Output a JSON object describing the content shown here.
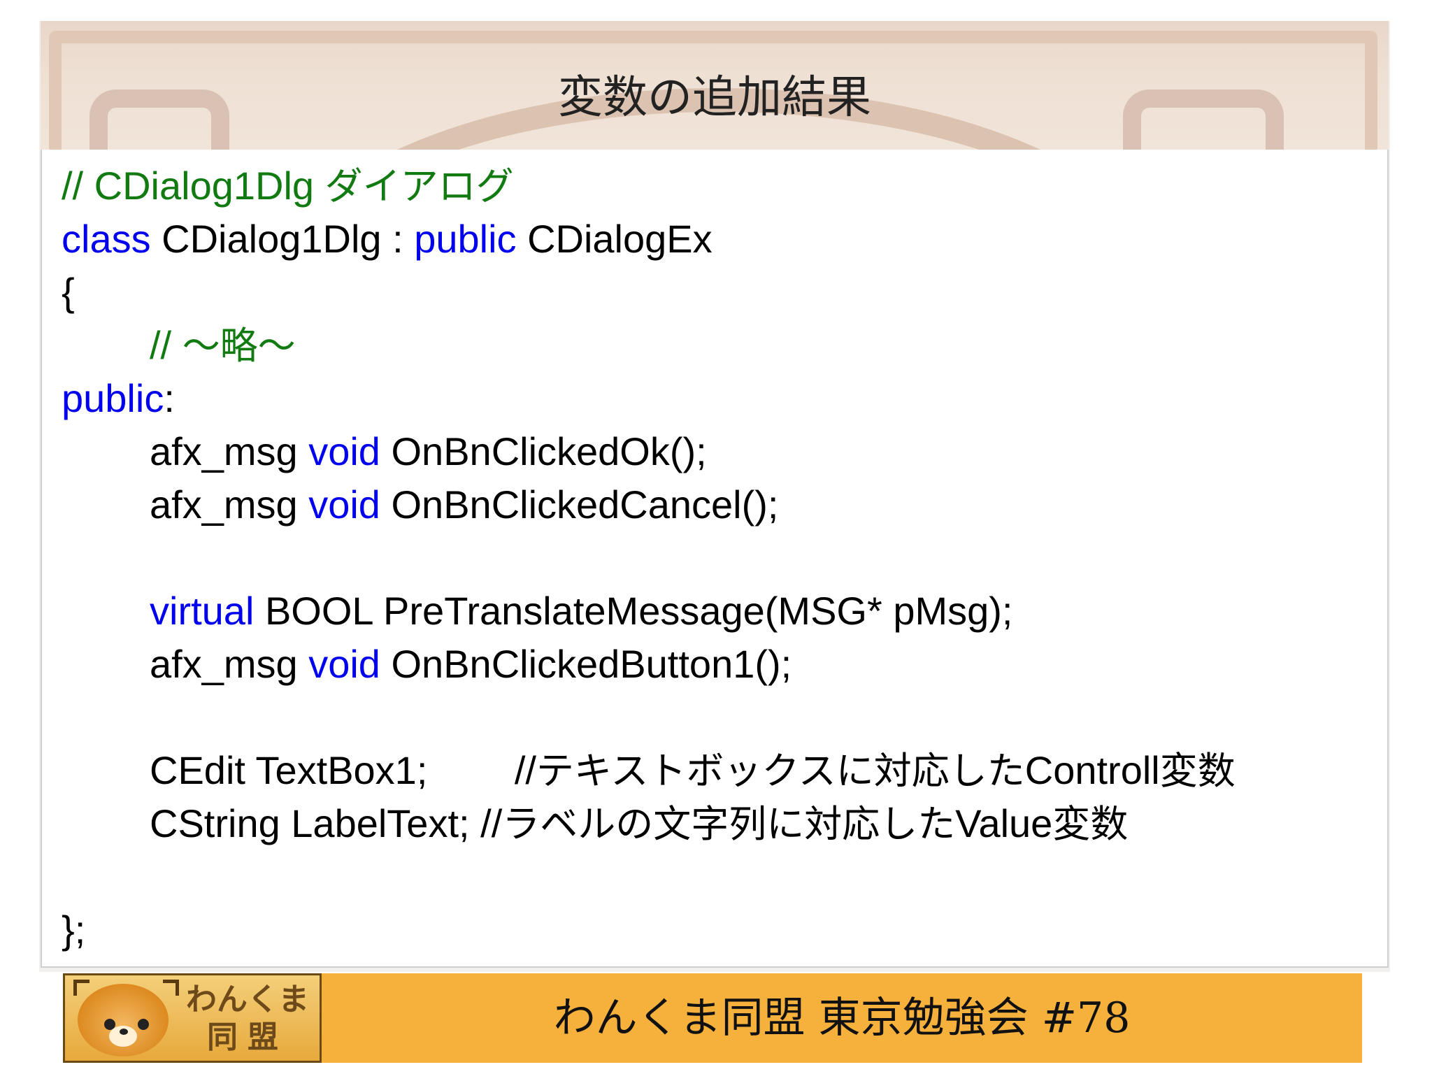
{
  "slide": {
    "title": "変数の追加結果",
    "footer": "わんくま同盟 東京勉強会 #78",
    "logo": {
      "line1": "わんくま",
      "line2": "同盟"
    }
  },
  "colors": {
    "keyword": "#0000ee",
    "comment": "#117a11",
    "footer_bar": "#f6b13c"
  },
  "code": {
    "l1_comment_a": "// CDialog1Dlg ",
    "l1_comment_b": "ダイアログ",
    "l2_kw1": "class",
    "l2_mid": " CDialog1Dlg : ",
    "l2_kw2": "public",
    "l2_end": " CDialogEx",
    "l3": "{",
    "l4_a": "// ",
    "l4_b": "〜略〜",
    "l5_kw": "public",
    "l5_colon": ":",
    "l6_a": "afx_msg ",
    "l6_kw": "void",
    "l6_b": " OnBnClickedOk();",
    "l7_a": "afx_msg ",
    "l7_kw": "void",
    "l7_b": " OnBnClickedCancel();",
    "l8_kw": "virtual",
    "l8_b": " BOOL PreTranslateMessage(MSG* pMsg);",
    "l9_a": "afx_msg ",
    "l9_kw": "void",
    "l9_b": " OnBnClickedButton1();",
    "l10_a": "CEdit TextBox1;        //",
    "l10_jp1": "テキストボックスに対応した",
    "l10_b": "Controll",
    "l10_jp2": "変数",
    "l11_a": "CString LabelText; //",
    "l11_jp1": "ラベルの文字列に対応した",
    "l11_b": "Value",
    "l11_jp2": "変数",
    "l12": "};"
  }
}
